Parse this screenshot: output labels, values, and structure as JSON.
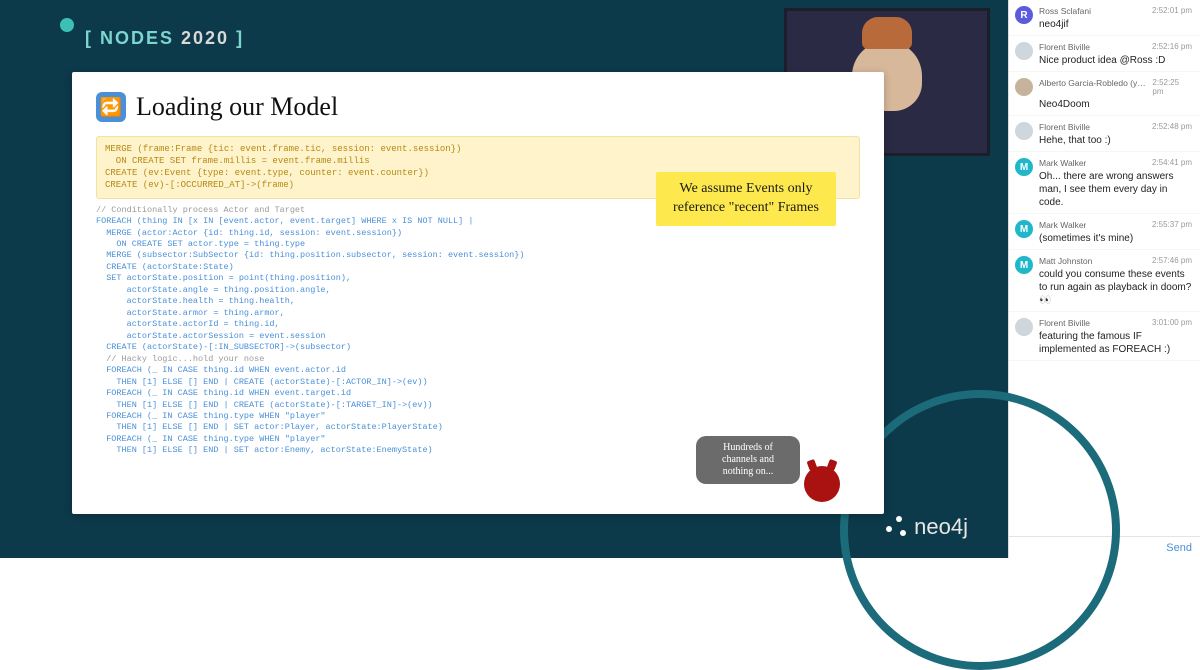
{
  "header": {
    "label_left": "[ NODES ",
    "label_year": "2020",
    "label_right": " ]"
  },
  "logo": {
    "text": "neo4j"
  },
  "slide": {
    "title": "Loading our Model",
    "code_header": "MERGE (frame:Frame {tic: event.frame.tic, session: event.session})\n  ON CREATE SET frame.millis = event.frame.millis\nCREATE (ev:Event {type: event.type, counter: event.counter})\nCREATE (ev)-[:OCCURRED_AT]->(frame)",
    "code_body_lines": [
      {
        "cls": "cmt",
        "t": "// Conditionally process Actor and Target"
      },
      {
        "cls": "kw",
        "t": "FOREACH (thing IN [x IN [event.actor, event.target] WHERE x IS NOT NULL] |"
      },
      {
        "cls": "kw",
        "t": "  MERGE (actor:Actor {id: thing.id, session: event.session})"
      },
      {
        "cls": "kw",
        "t": "    ON CREATE SET actor.type = thing.type"
      },
      {
        "cls": "kw",
        "t": "  MERGE (subsector:SubSector {id: thing.position.subsector, session: event.session})"
      },
      {
        "cls": "kw",
        "t": "  CREATE (actorState:State)"
      },
      {
        "cls": "kw",
        "t": "  SET actorState.position = point(thing.position),"
      },
      {
        "cls": "kw",
        "t": "      actorState.angle = thing.position.angle,"
      },
      {
        "cls": "kw",
        "t": "      actorState.health = thing.health,"
      },
      {
        "cls": "kw",
        "t": "      actorState.armor = thing.armor,"
      },
      {
        "cls": "kw",
        "t": "      actorState.actorId = thing.id,"
      },
      {
        "cls": "kw",
        "t": "      actorState.actorSession = event.session"
      },
      {
        "cls": "kw",
        "t": "  CREATE (actorState)-[:IN_SUBSECTOR]->(subsector)"
      },
      {
        "cls": "cmt",
        "t": "  // Hacky logic...hold your nose"
      },
      {
        "cls": "kw",
        "t": "  FOREACH (_ IN CASE thing.id WHEN event.actor.id"
      },
      {
        "cls": "kw",
        "t": "    THEN [1] ELSE [] END | CREATE (actorState)-[:ACTOR_IN]->(ev))"
      },
      {
        "cls": "kw",
        "t": "  FOREACH (_ IN CASE thing.id WHEN event.target.id"
      },
      {
        "cls": "kw",
        "t": "    THEN [1] ELSE [] END | CREATE (actorState)-[:TARGET_IN]->(ev))"
      },
      {
        "cls": "kw",
        "t": "  FOREACH (_ IN CASE thing.type WHEN \"player\""
      },
      {
        "cls": "kw",
        "t": "    THEN [1] ELSE [] END | SET actor:Player, actorState:PlayerState)"
      },
      {
        "cls": "kw",
        "t": "  FOREACH (_ IN CASE thing.type WHEN \"player\""
      },
      {
        "cls": "kw",
        "t": "    THEN [1] ELSE [] END | SET actor:Enemy, actorState:EnemyState)"
      }
    ],
    "sticky": "We assume Events only reference \"recent\" Frames",
    "speech_bubble": "Hundreds of channels and nothing on..."
  },
  "chat": {
    "messages": [
      {
        "avatar": "R",
        "color": "#5b5be0",
        "name": "Ross Sclafani",
        "time": "2:52:01 pm",
        "text": "neo4jif"
      },
      {
        "avatar": "",
        "color": "#cfd6dc",
        "name": "Florent Biville",
        "time": "2:52:16 pm",
        "text": "Nice product idea @Ross :D"
      },
      {
        "avatar": "",
        "color": "#c6b39c",
        "name": "Alberto Garcia-Robledo (you)",
        "time": "2:52:25 pm",
        "text": "Neo4Doom"
      },
      {
        "avatar": "",
        "color": "#cfd6dc",
        "name": "Florent Biville",
        "time": "2:52:48 pm",
        "text": "Hehe, that too :)"
      },
      {
        "avatar": "M",
        "color": "#20b8c9",
        "name": "Mark Walker",
        "time": "2:54:41 pm",
        "text": "Oh... there are wrong answers man, I see them every day in code."
      },
      {
        "avatar": "M",
        "color": "#20b8c9",
        "name": "Mark Walker",
        "time": "2:55:37 pm",
        "text": "(sometimes it's mine)"
      },
      {
        "avatar": "M",
        "color": "#20b8c9",
        "name": "Matt Johnston",
        "time": "2:57:46 pm",
        "text": "could you consume these events to run again as playback in doom? 👀"
      },
      {
        "avatar": "",
        "color": "#cfd6dc",
        "name": "Florent Biville",
        "time": "3:01:00 pm",
        "text": "featuring the famous IF implemented as FOREACH :)"
      }
    ],
    "send_label": "Send"
  }
}
